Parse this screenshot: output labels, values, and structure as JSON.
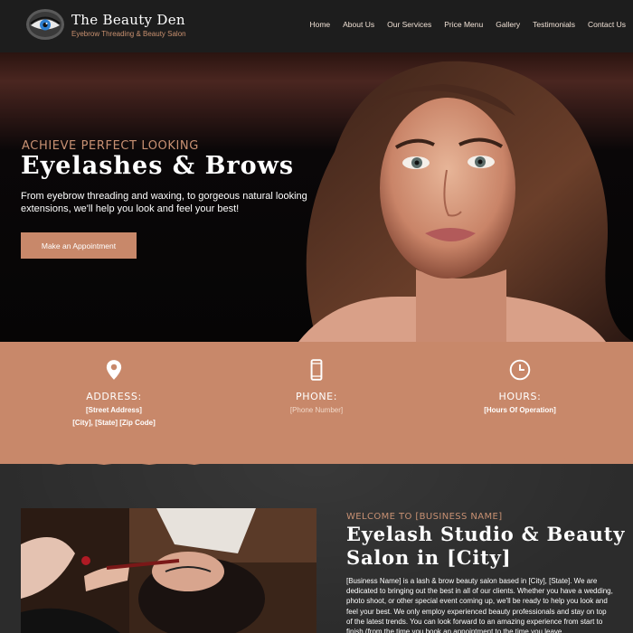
{
  "header": {
    "brand_name": "The Beauty Den",
    "brand_tagline": "Eyebrow Threading & Beauty Salon",
    "logo_icon": "eye-logo-icon",
    "nav": [
      "Home",
      "About Us",
      "Our Services",
      "Price Menu",
      "Gallery",
      "Testimonials",
      "Contact Us"
    ]
  },
  "hero": {
    "eyebrow": "ACHIEVE PERFECT LOOKING",
    "title": "Eyelashes & Brows",
    "description": "From eyebrow threading and waxing, to gorgeous natural looking extensions, we'll help you look and feel your best!",
    "cta_label": "Make an Appointment"
  },
  "info": {
    "address": {
      "icon": "map-pin-icon",
      "label": "ADDRESS:",
      "line1": "[Street Address]",
      "line2": "[City], [State] [Zip Code]"
    },
    "phone": {
      "icon": "mobile-phone-icon",
      "label": "PHONE:",
      "value": "[Phone Number]"
    },
    "hours": {
      "icon": "clock-icon",
      "label": "HOURS:",
      "value": "[Hours Of Operation]"
    }
  },
  "welcome": {
    "eyebrow": "WELCOME TO [BUSINESS NAME]",
    "title": "Eyelash Studio & Beauty Salon in [City]",
    "body": "[Business Name] is a lash & brow beauty salon based in [City], [State]. We are dedicated to bringing out the best in all of our clients. Whether you have a wedding, photo shoot, or other special event coming up, we'll be ready to help you look and feel your best. We only employ experienced beauty professionals and stay on top of the latest trends. You can look forward to an amazing experience from start to finish (from the time you book an appointment to the time you leave"
  },
  "colors": {
    "accent": "#c8886a",
    "accent_text": "#c89173",
    "header_bg": "#1d1d1d",
    "section_bg": "#2c2c2c"
  }
}
